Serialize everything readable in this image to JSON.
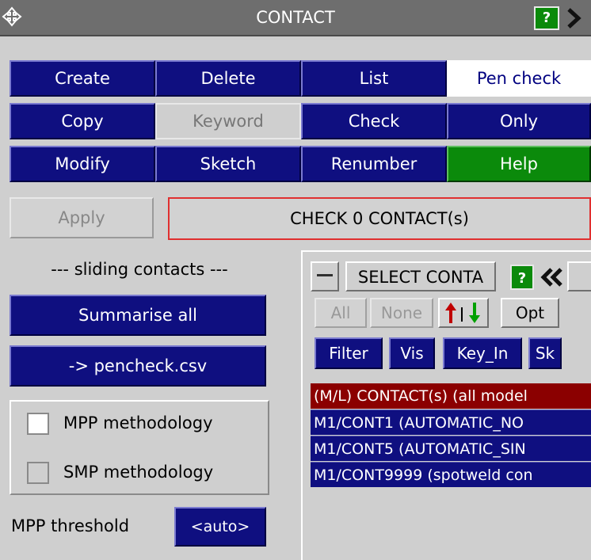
{
  "window": {
    "title": "CONTACT",
    "help_label": "?"
  },
  "buttons": {
    "create": "Create",
    "delete": "Delete",
    "list": "List",
    "pen_check": "Pen check",
    "copy": "Copy",
    "keyword": "Keyword",
    "check": "Check",
    "only": "Only",
    "modify": "Modify",
    "sketch": "Sketch",
    "renumber": "Renumber",
    "help": "Help"
  },
  "apply_label": "Apply",
  "command_text": "CHECK 0 CONTACT(s)",
  "left": {
    "section_heading": "--- sliding contacts ---",
    "summarise_label": "Summarise all",
    "csv_label": "-> pencheck.csv",
    "mpp_label": "MPP methodology",
    "smp_label": "SMP methodology",
    "threshold_label": "MPP threshold",
    "threshold_value": "<auto>"
  },
  "select_panel": {
    "title": "SELECT CONTA",
    "help_label": "?",
    "all": "All",
    "none": "None",
    "opt": "Opt",
    "filter": "Filter",
    "vis": "Vis",
    "key_in": "Key_In",
    "sk": "Sk",
    "items": [
      "(M/L) CONTACT(s) (all model",
      "M1/CONT1 (AUTOMATIC_NO",
      "M1/CONT5 (AUTOMATIC_SIN",
      "M1/CONT9999 (spotweld con"
    ]
  },
  "colors": {
    "button_blue": "#0f0f80",
    "help_green": "#0b8a0b",
    "selected_red": "#8b0000",
    "background": "#cfcfcf"
  }
}
